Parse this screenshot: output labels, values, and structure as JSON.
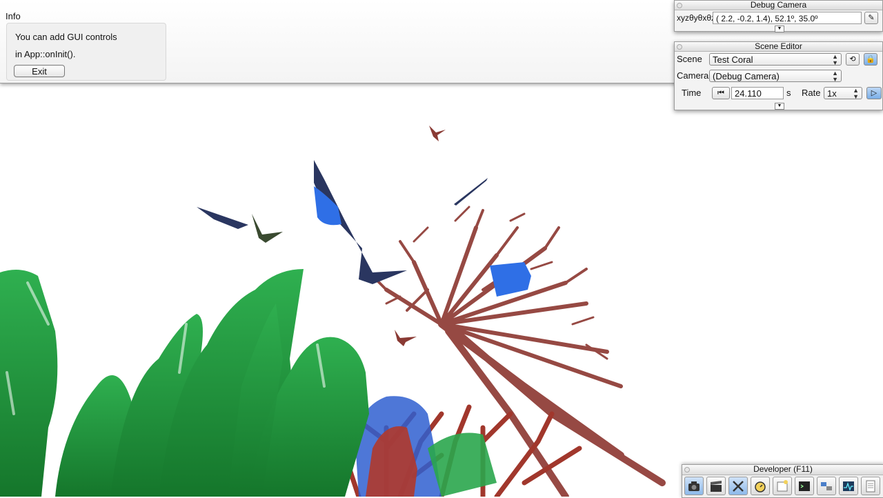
{
  "info_panel": {
    "title": "Info",
    "line1": "You can add GUI controls",
    "line2": "in App::onInit().",
    "exit_label": "Exit"
  },
  "debug_camera": {
    "title": "Debug Camera",
    "label": "xyzθyθxθz",
    "value": "(  2.2,  -0.2,   1.4),  52.1º,  35.0º"
  },
  "scene_editor": {
    "title": "Scene Editor",
    "scene_label": "Scene",
    "scene_value": "Test Coral",
    "camera_label": "Camera",
    "camera_value": "(Debug Camera)",
    "time_label": "Time",
    "time_value": "24.110",
    "time_unit": "s",
    "rate_label": "Rate",
    "rate_value": "1x"
  },
  "developer_bar": {
    "title": "Developer (F11)",
    "icons": [
      "camera-icon",
      "clapperboard-icon",
      "tools-icon",
      "stopwatch-icon",
      "new-window-icon",
      "terminal-icon",
      "scene-graph-icon",
      "profiler-icon",
      "log-icon"
    ]
  },
  "colors": {
    "coral_green": "#1f9a3e",
    "coral_red": "#9c3a32",
    "coral_blue": "#2e6fe0",
    "fish_navy": "#27335c",
    "accent_blue": "#7aaee8"
  }
}
